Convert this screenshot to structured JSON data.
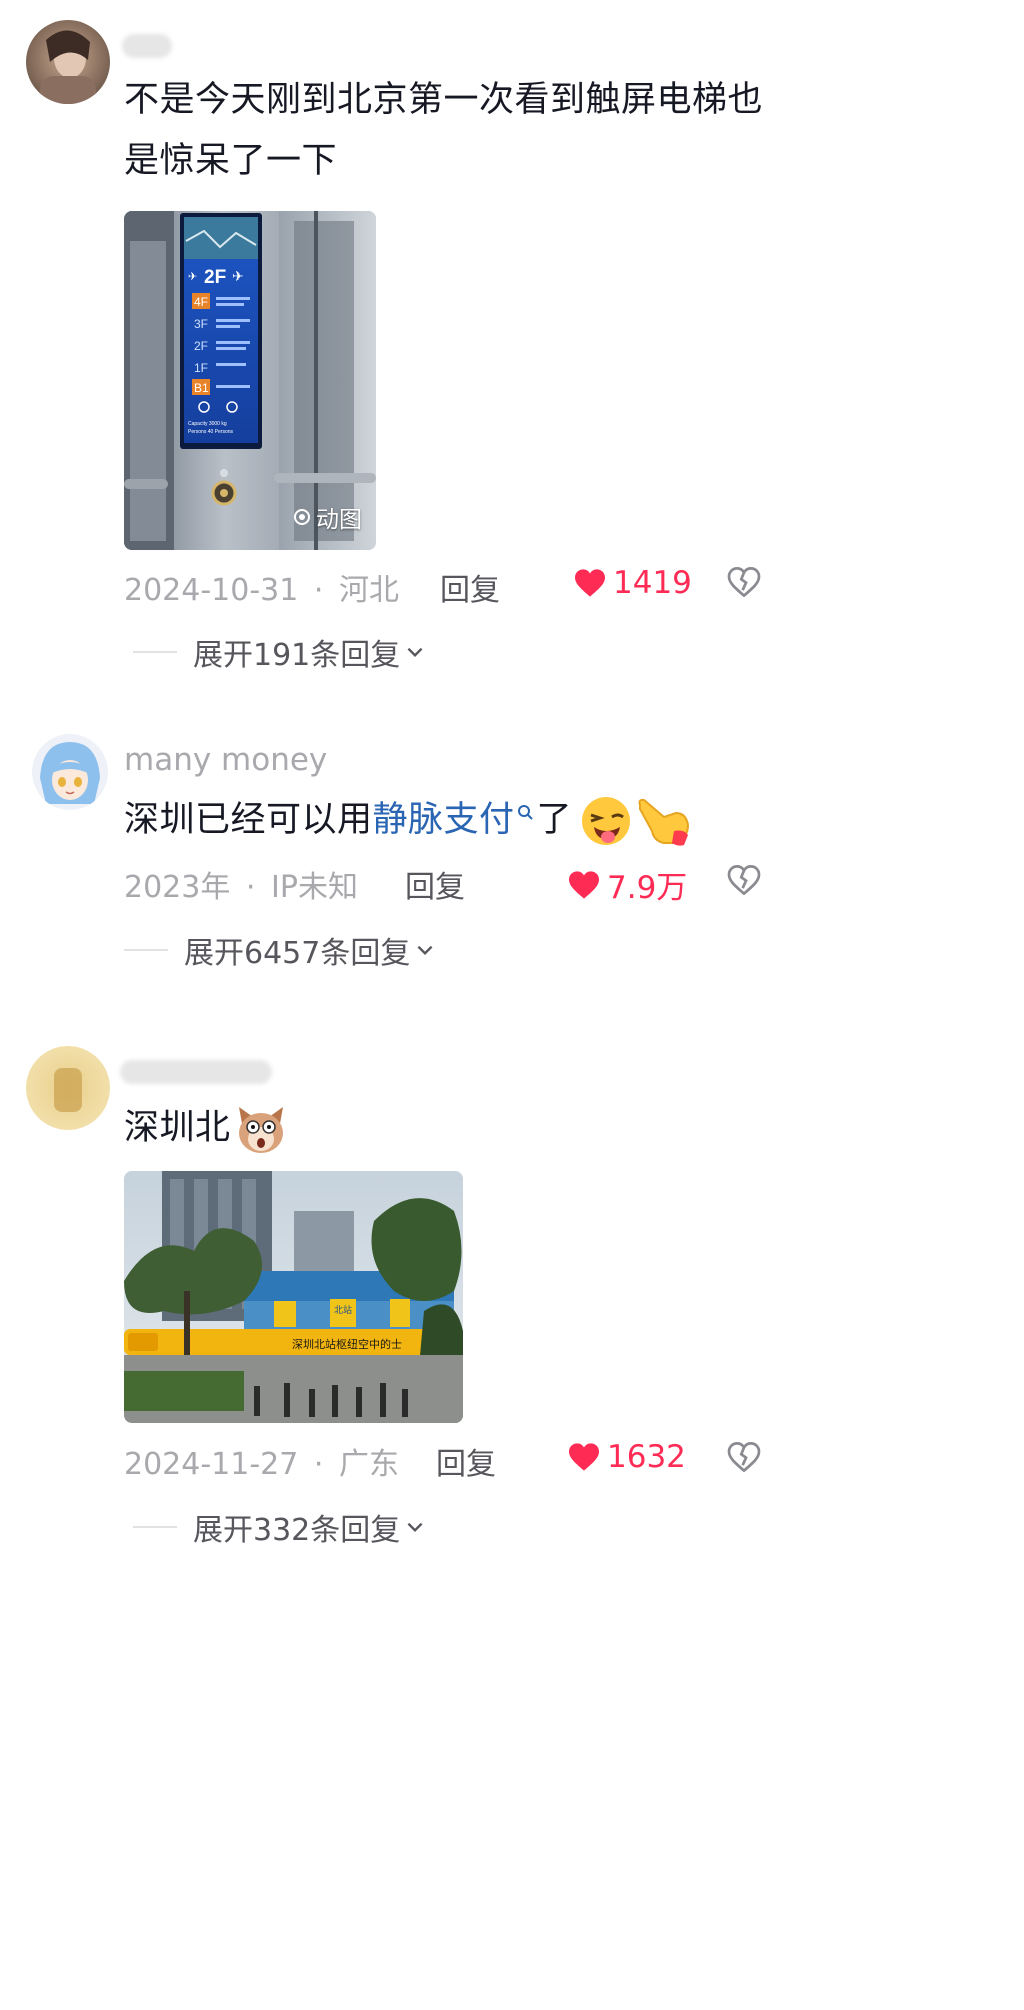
{
  "comments": [
    {
      "text": "不是今天刚到北京第一次看到触屏电梯也是惊呆了一下",
      "media": {
        "badge": "动图",
        "panel": {
          "floor_current": "2F",
          "floors": [
            "4F",
            "3F",
            "2F",
            "1F",
            "B1"
          ],
          "capacity_line1": "Capacity 3000 kg",
          "capacity_line2": "Persons 40 Persons"
        }
      },
      "date": "2024-10-31",
      "location": "河北",
      "reply_label": "回复",
      "likes": "1419",
      "expand_label": "展开191条回复"
    },
    {
      "username": "many money",
      "text_before": "深圳已经可以用",
      "link_text": "静脉支付",
      "text_after": "了",
      "date": "2023年",
      "location": "IP未知",
      "reply_label": "回复",
      "likes": "7.9万",
      "expand_label": "展开6457条回复"
    },
    {
      "text": "深圳北",
      "media": {
        "banner_text": "深圳北站枢纽空中的士",
        "sign_text": "北站"
      },
      "date": "2024-11-27",
      "location": "广东",
      "reply_label": "回复",
      "likes": "1632",
      "expand_label": "展开332条回复"
    }
  ],
  "separator": "·",
  "colors": {
    "like": "#fe2c55",
    "link": "#2a65b3",
    "meta": "#a9a9ad",
    "reply": "#56565c"
  }
}
